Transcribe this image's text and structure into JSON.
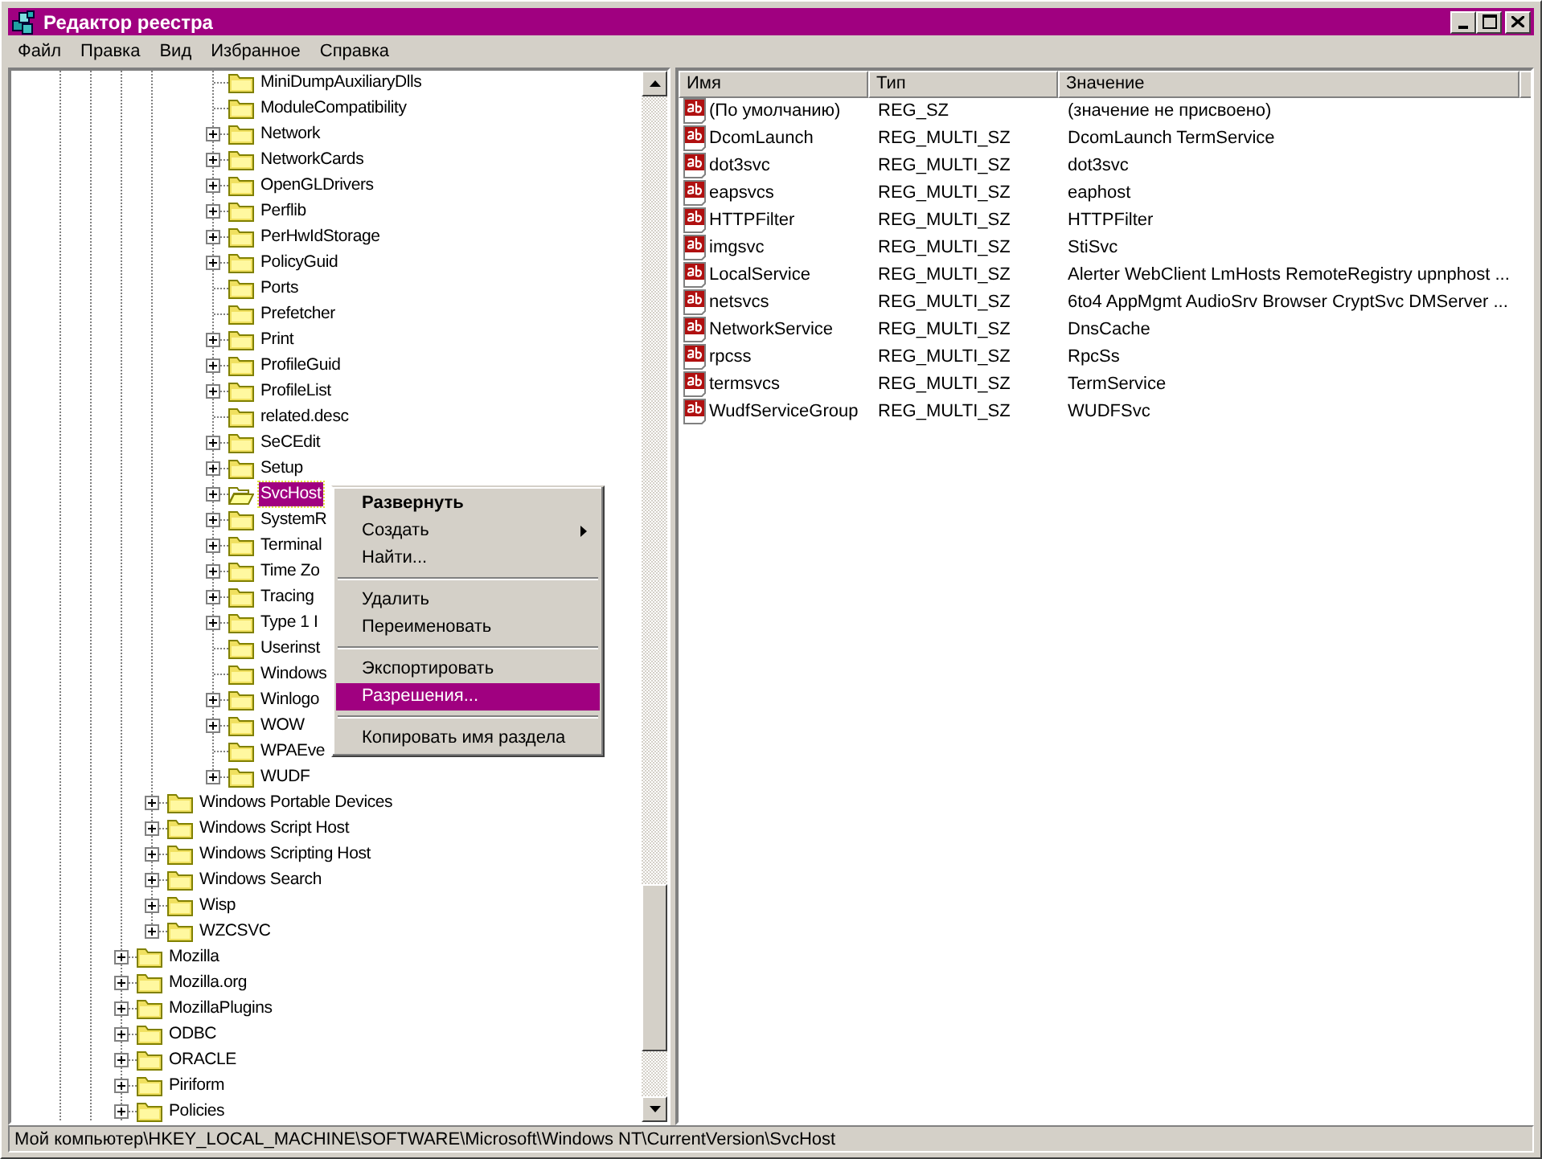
{
  "window": {
    "title": "Редактор реестра"
  },
  "menu_bar": [
    "Файл",
    "Правка",
    "Вид",
    "Избранное",
    "Справка"
  ],
  "tree": {
    "items": [
      {
        "children": [
          {
            "children": [
              {
                "children": [
                  {
                    "label": "MiniDumpAuxiliaryDlls",
                    "expandable": false,
                    "selected": false
                  },
                  {
                    "label": "ModuleCompatibility",
                    "expandable": false,
                    "selected": false
                  },
                  {
                    "label": "Network",
                    "expandable": true,
                    "selected": false
                  },
                  {
                    "label": "NetworkCards",
                    "expandable": true,
                    "selected": false
                  },
                  {
                    "label": "OpenGLDrivers",
                    "expandable": true,
                    "selected": false
                  },
                  {
                    "label": "Perflib",
                    "expandable": true,
                    "selected": false
                  },
                  {
                    "label": "PerHwIdStorage",
                    "expandable": true,
                    "selected": false
                  },
                  {
                    "label": "PolicyGuid",
                    "expandable": true,
                    "selected": false
                  },
                  {
                    "label": "Ports",
                    "expandable": false,
                    "selected": false
                  },
                  {
                    "label": "Prefetcher",
                    "expandable": false,
                    "selected": false
                  },
                  {
                    "label": "Print",
                    "expandable": true,
                    "selected": false
                  },
                  {
                    "label": "ProfileGuid",
                    "expandable": true,
                    "selected": false
                  },
                  {
                    "label": "ProfileList",
                    "expandable": true,
                    "selected": false
                  },
                  {
                    "label": "related.desc",
                    "expandable": false,
                    "selected": false
                  },
                  {
                    "label": "SeCEdit",
                    "expandable": true,
                    "selected": false
                  },
                  {
                    "label": "Setup",
                    "expandable": true,
                    "selected": false
                  },
                  {
                    "label": "SvcHost",
                    "expandable": true,
                    "selected": true
                  },
                  {
                    "label": "SystemR",
                    "expandable": true,
                    "selected": false
                  },
                  {
                    "label": "Terminal",
                    "expandable": true,
                    "selected": false
                  },
                  {
                    "label": "Time Zo",
                    "expandable": true,
                    "selected": false
                  },
                  {
                    "label": "Tracing",
                    "expandable": true,
                    "selected": false
                  },
                  {
                    "label": "Type 1 I",
                    "expandable": true,
                    "selected": false
                  },
                  {
                    "label": "Userinst",
                    "expandable": false,
                    "selected": false
                  },
                  {
                    "label": "Windows",
                    "expandable": false,
                    "selected": false
                  },
                  {
                    "label": "Winlogo",
                    "expandable": true,
                    "selected": false
                  },
                  {
                    "label": "WOW",
                    "expandable": true,
                    "selected": false
                  },
                  {
                    "label": "WPAEve",
                    "expandable": false,
                    "selected": false
                  },
                  {
                    "label": "WUDF",
                    "expandable": true,
                    "selected": false
                  }
                ]
              }
            ]
          },
          {
            "label": "Windows Portable Devices",
            "expandable": true,
            "selected": false
          },
          {
            "label": "Windows Script Host",
            "expandable": true,
            "selected": false
          },
          {
            "label": "Windows Scripting Host",
            "expandable": true,
            "selected": false
          },
          {
            "label": "Windows Search",
            "expandable": true,
            "selected": false
          },
          {
            "label": "Wisp",
            "expandable": true,
            "selected": false
          },
          {
            "label": "WZCSVC",
            "expandable": true,
            "selected": false
          }
        ]
      },
      {
        "label": "Mozilla",
        "expandable": true,
        "selected": false
      },
      {
        "label": "Mozilla.org",
        "expandable": true,
        "selected": false
      },
      {
        "label": "MozillaPlugins",
        "expandable": true,
        "selected": false
      },
      {
        "label": "ODBC",
        "expandable": true,
        "selected": false
      },
      {
        "label": "ORACLE",
        "expandable": true,
        "selected": false
      },
      {
        "label": "Piriform",
        "expandable": true,
        "selected": false
      },
      {
        "label": "Policies",
        "expandable": true,
        "selected": false
      }
    ]
  },
  "values_list": {
    "columns": [
      "Имя",
      "Тип",
      "Значение"
    ],
    "rows": [
      {
        "name": "(По умолчанию)",
        "type": "REG_SZ",
        "value": "(значение не присвоено)"
      },
      {
        "name": "DcomLaunch",
        "type": "REG_MULTI_SZ",
        "value": "DcomLaunch TermService"
      },
      {
        "name": "dot3svc",
        "type": "REG_MULTI_SZ",
        "value": "dot3svc"
      },
      {
        "name": "eapsvcs",
        "type": "REG_MULTI_SZ",
        "value": "eaphost"
      },
      {
        "name": "HTTPFilter",
        "type": "REG_MULTI_SZ",
        "value": "HTTPFilter"
      },
      {
        "name": "imgsvc",
        "type": "REG_MULTI_SZ",
        "value": "StiSvc"
      },
      {
        "name": "LocalService",
        "type": "REG_MULTI_SZ",
        "value": "Alerter WebClient LmHosts RemoteRegistry upnphost ..."
      },
      {
        "name": "netsvcs",
        "type": "REG_MULTI_SZ",
        "value": "6to4 AppMgmt AudioSrv Browser CryptSvc DMServer ..."
      },
      {
        "name": "NetworkService",
        "type": "REG_MULTI_SZ",
        "value": "DnsCache"
      },
      {
        "name": "rpcss",
        "type": "REG_MULTI_SZ",
        "value": "RpcSs"
      },
      {
        "name": "termsvcs",
        "type": "REG_MULTI_SZ",
        "value": "TermService"
      },
      {
        "name": "WudfServiceGroup",
        "type": "REG_MULTI_SZ",
        "value": "WUDFSvc"
      }
    ]
  },
  "context_menu": [
    {
      "kind": "item",
      "label": "Развернуть",
      "default": true,
      "submenu": false,
      "selected": false
    },
    {
      "kind": "item",
      "label": "Создать",
      "default": false,
      "submenu": true,
      "selected": false
    },
    {
      "kind": "item",
      "label": "Найти...",
      "default": false,
      "submenu": false,
      "selected": false
    },
    {
      "kind": "separator"
    },
    {
      "kind": "item",
      "label": "Удалить",
      "default": false,
      "submenu": false,
      "selected": false
    },
    {
      "kind": "item",
      "label": "Переименовать",
      "default": false,
      "submenu": false,
      "selected": false
    },
    {
      "kind": "separator"
    },
    {
      "kind": "item",
      "label": "Экспортировать",
      "default": false,
      "submenu": false,
      "selected": false
    },
    {
      "kind": "item",
      "label": "Разрешения...",
      "default": false,
      "submenu": false,
      "selected": true
    },
    {
      "kind": "separator"
    },
    {
      "kind": "item",
      "label": "Копировать имя раздела",
      "default": false,
      "submenu": false,
      "selected": false
    }
  ],
  "status_bar": "Мой компьютер\\HKEY_LOCAL_MACHINE\\SOFTWARE\\Microsoft\\Windows NT\\CurrentVersion\\SvcHost"
}
